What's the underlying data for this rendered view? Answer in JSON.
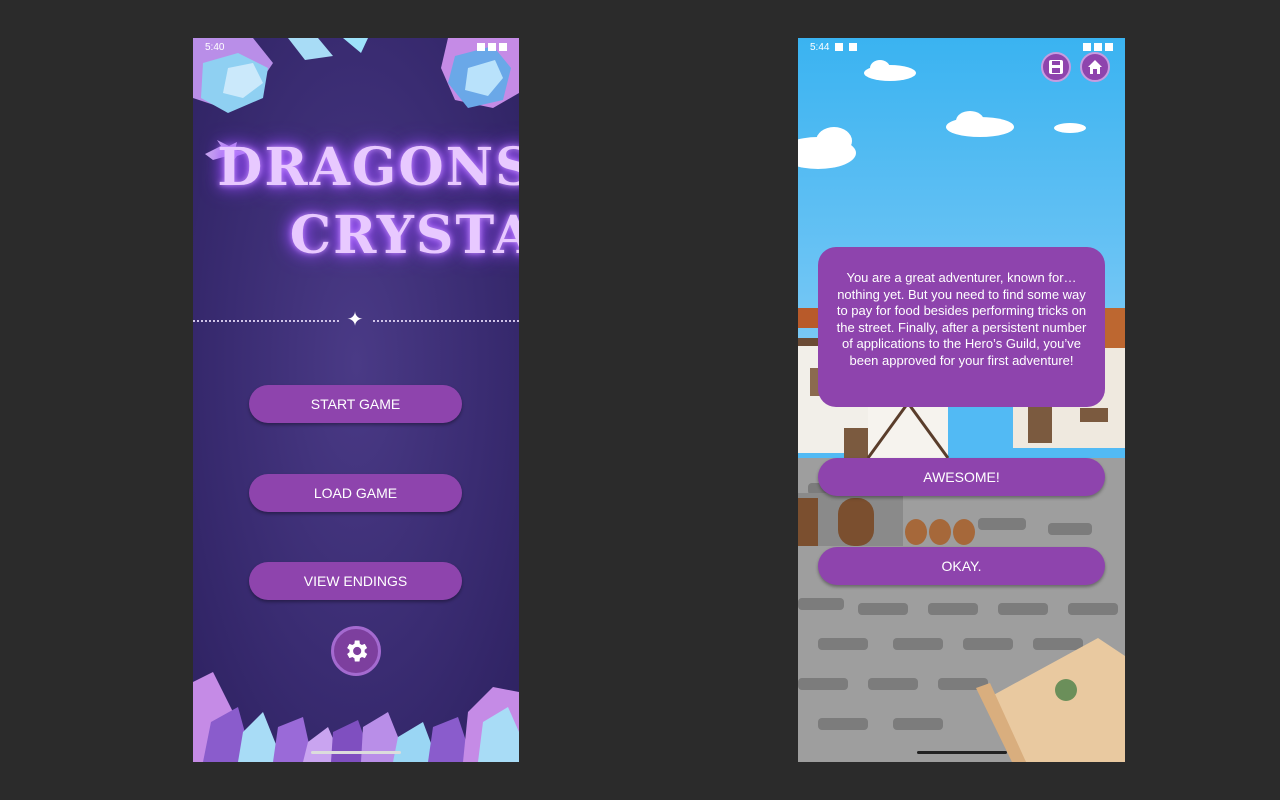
{
  "left_screen": {
    "status": {
      "time": "5:40"
    },
    "title": {
      "line1": "DRAGONS",
      "line2": "CRYSTAL"
    },
    "buttons": {
      "start": "START GAME",
      "load": "LOAD GAME",
      "endings": "VIEW ENDINGS"
    },
    "icons": {
      "settings": "gear-icon",
      "divider": "sparkle-icon"
    }
  },
  "right_screen": {
    "status": {
      "time": "5:44"
    },
    "icons": {
      "save": "floppy-disk-icon",
      "home": "home-icon"
    },
    "dialog_text": "You are a great adventurer, known for… nothing yet. But you need to find some way to pay for food besides performing tricks on the street. Finally, after a persistent number of applications to the Hero’s Guild, you’ve been approved for your first adventure!",
    "choices": {
      "first": "AWESOME!",
      "second": "OKAY."
    }
  },
  "colors": {
    "page_bg": "#2b2b2b",
    "button_purple": "#8e44ad",
    "title_glow": "#e8c9ff",
    "sky_blue": "#52baf4",
    "cobblestone": "#9e9e9e"
  }
}
